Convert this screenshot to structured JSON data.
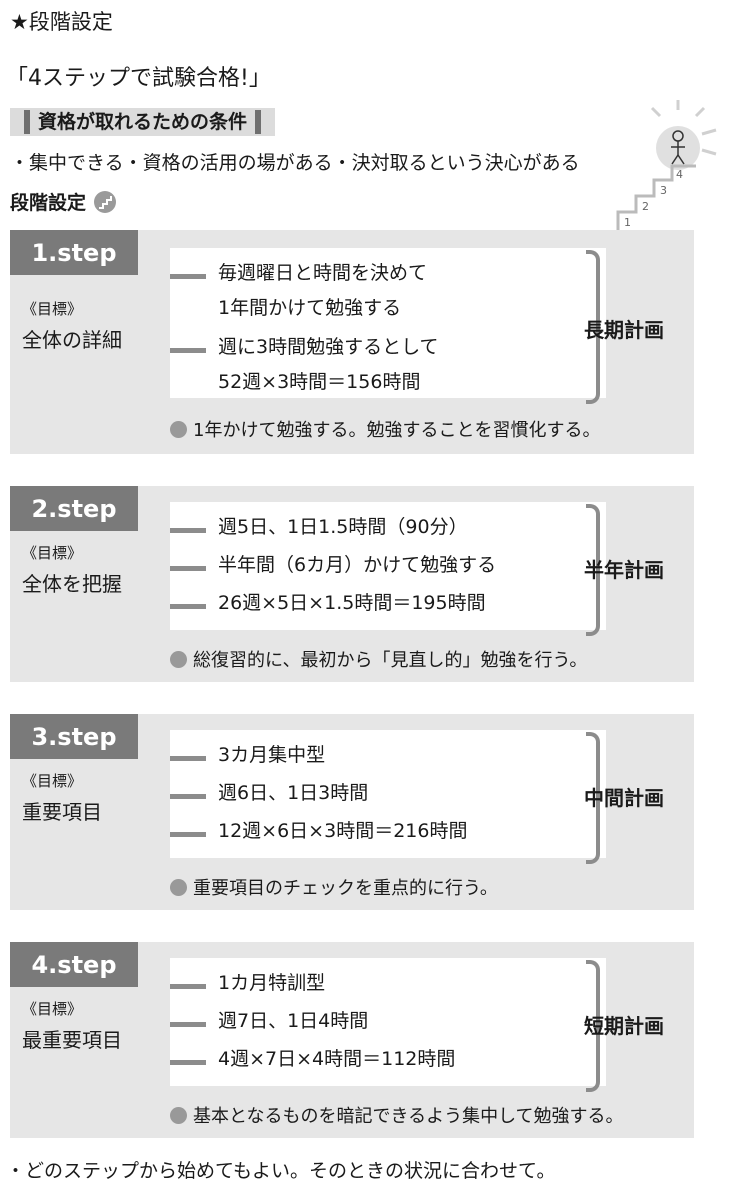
{
  "header": "★段階設定",
  "title": "「4ステップで試験合格!」",
  "conditions": {
    "heading": "資格が取れるための条件",
    "text": "・集中できる・資格の活用の場がある・決対取るという決心がある"
  },
  "stage_label": "段階設定",
  "stair_numbers": [
    "1",
    "2",
    "3",
    "4"
  ],
  "steps": [
    {
      "badge": "1.step",
      "goal_label": "《目標》",
      "goal": "全体の詳細",
      "items": [
        "毎週曜日と時間を決めて\n1年間かけて勉強する",
        "週に3時間勉強するとして\n52週×3時間＝156時間"
      ],
      "period": "長期計画",
      "summary": "1年かけて勉強する。勉強することを習慣化する。"
    },
    {
      "badge": "2.step",
      "goal_label": "《目標》",
      "goal": "全体を把握",
      "items": [
        "週5日、1日1.5時間（90分）",
        "半年間（6カ月）かけて勉強する",
        "26週×5日×1.5時間＝195時間"
      ],
      "period": "半年計画",
      "summary": "総復習的に、最初から「見直し的」勉強を行う。"
    },
    {
      "badge": "3.step",
      "goal_label": "《目標》",
      "goal": "重要項目",
      "items": [
        "3カ月集中型",
        "週6日、1日3時間",
        "12週×6日×3時間＝216時間"
      ],
      "period": "中間計画",
      "summary": "重要項目のチェックを重点的に行う。"
    },
    {
      "badge": "4.step",
      "goal_label": "《目標》",
      "goal": "最重要項目",
      "items": [
        "1カ月特訓型",
        "週7日、1日4時間",
        "4週×7日×4時間＝112時間"
      ],
      "period": "短期計画",
      "summary": "基本となるものを暗記できるよう集中して勉強する。"
    }
  ],
  "footer": "・どのステップから始めてもよい。そのときの状況に合わせて。"
}
